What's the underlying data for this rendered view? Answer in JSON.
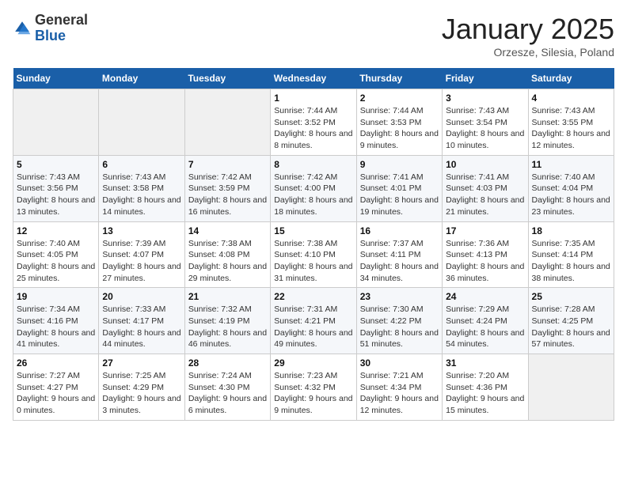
{
  "header": {
    "logo_general": "General",
    "logo_blue": "Blue",
    "month_title": "January 2025",
    "subtitle": "Orzesze, Silesia, Poland"
  },
  "calendar": {
    "weekdays": [
      "Sunday",
      "Monday",
      "Tuesday",
      "Wednesday",
      "Thursday",
      "Friday",
      "Saturday"
    ],
    "rows": [
      {
        "cells": [
          {
            "day": "",
            "info": ""
          },
          {
            "day": "",
            "info": ""
          },
          {
            "day": "",
            "info": ""
          },
          {
            "day": "1",
            "info": "Sunrise: 7:44 AM\nSunset: 3:52 PM\nDaylight: 8 hours and 8 minutes."
          },
          {
            "day": "2",
            "info": "Sunrise: 7:44 AM\nSunset: 3:53 PM\nDaylight: 8 hours and 9 minutes."
          },
          {
            "day": "3",
            "info": "Sunrise: 7:43 AM\nSunset: 3:54 PM\nDaylight: 8 hours and 10 minutes."
          },
          {
            "day": "4",
            "info": "Sunrise: 7:43 AM\nSunset: 3:55 PM\nDaylight: 8 hours and 12 minutes."
          }
        ]
      },
      {
        "cells": [
          {
            "day": "5",
            "info": "Sunrise: 7:43 AM\nSunset: 3:56 PM\nDaylight: 8 hours and 13 minutes."
          },
          {
            "day": "6",
            "info": "Sunrise: 7:43 AM\nSunset: 3:58 PM\nDaylight: 8 hours and 14 minutes."
          },
          {
            "day": "7",
            "info": "Sunrise: 7:42 AM\nSunset: 3:59 PM\nDaylight: 8 hours and 16 minutes."
          },
          {
            "day": "8",
            "info": "Sunrise: 7:42 AM\nSunset: 4:00 PM\nDaylight: 8 hours and 18 minutes."
          },
          {
            "day": "9",
            "info": "Sunrise: 7:41 AM\nSunset: 4:01 PM\nDaylight: 8 hours and 19 minutes."
          },
          {
            "day": "10",
            "info": "Sunrise: 7:41 AM\nSunset: 4:03 PM\nDaylight: 8 hours and 21 minutes."
          },
          {
            "day": "11",
            "info": "Sunrise: 7:40 AM\nSunset: 4:04 PM\nDaylight: 8 hours and 23 minutes."
          }
        ]
      },
      {
        "cells": [
          {
            "day": "12",
            "info": "Sunrise: 7:40 AM\nSunset: 4:05 PM\nDaylight: 8 hours and 25 minutes."
          },
          {
            "day": "13",
            "info": "Sunrise: 7:39 AM\nSunset: 4:07 PM\nDaylight: 8 hours and 27 minutes."
          },
          {
            "day": "14",
            "info": "Sunrise: 7:38 AM\nSunset: 4:08 PM\nDaylight: 8 hours and 29 minutes."
          },
          {
            "day": "15",
            "info": "Sunrise: 7:38 AM\nSunset: 4:10 PM\nDaylight: 8 hours and 31 minutes."
          },
          {
            "day": "16",
            "info": "Sunrise: 7:37 AM\nSunset: 4:11 PM\nDaylight: 8 hours and 34 minutes."
          },
          {
            "day": "17",
            "info": "Sunrise: 7:36 AM\nSunset: 4:13 PM\nDaylight: 8 hours and 36 minutes."
          },
          {
            "day": "18",
            "info": "Sunrise: 7:35 AM\nSunset: 4:14 PM\nDaylight: 8 hours and 38 minutes."
          }
        ]
      },
      {
        "cells": [
          {
            "day": "19",
            "info": "Sunrise: 7:34 AM\nSunset: 4:16 PM\nDaylight: 8 hours and 41 minutes."
          },
          {
            "day": "20",
            "info": "Sunrise: 7:33 AM\nSunset: 4:17 PM\nDaylight: 8 hours and 44 minutes."
          },
          {
            "day": "21",
            "info": "Sunrise: 7:32 AM\nSunset: 4:19 PM\nDaylight: 8 hours and 46 minutes."
          },
          {
            "day": "22",
            "info": "Sunrise: 7:31 AM\nSunset: 4:21 PM\nDaylight: 8 hours and 49 minutes."
          },
          {
            "day": "23",
            "info": "Sunrise: 7:30 AM\nSunset: 4:22 PM\nDaylight: 8 hours and 51 minutes."
          },
          {
            "day": "24",
            "info": "Sunrise: 7:29 AM\nSunset: 4:24 PM\nDaylight: 8 hours and 54 minutes."
          },
          {
            "day": "25",
            "info": "Sunrise: 7:28 AM\nSunset: 4:25 PM\nDaylight: 8 hours and 57 minutes."
          }
        ]
      },
      {
        "cells": [
          {
            "day": "26",
            "info": "Sunrise: 7:27 AM\nSunset: 4:27 PM\nDaylight: 9 hours and 0 minutes."
          },
          {
            "day": "27",
            "info": "Sunrise: 7:25 AM\nSunset: 4:29 PM\nDaylight: 9 hours and 3 minutes."
          },
          {
            "day": "28",
            "info": "Sunrise: 7:24 AM\nSunset: 4:30 PM\nDaylight: 9 hours and 6 minutes."
          },
          {
            "day": "29",
            "info": "Sunrise: 7:23 AM\nSunset: 4:32 PM\nDaylight: 9 hours and 9 minutes."
          },
          {
            "day": "30",
            "info": "Sunrise: 7:21 AM\nSunset: 4:34 PM\nDaylight: 9 hours and 12 minutes."
          },
          {
            "day": "31",
            "info": "Sunrise: 7:20 AM\nSunset: 4:36 PM\nDaylight: 9 hours and 15 minutes."
          },
          {
            "day": "",
            "info": ""
          }
        ]
      }
    ]
  }
}
